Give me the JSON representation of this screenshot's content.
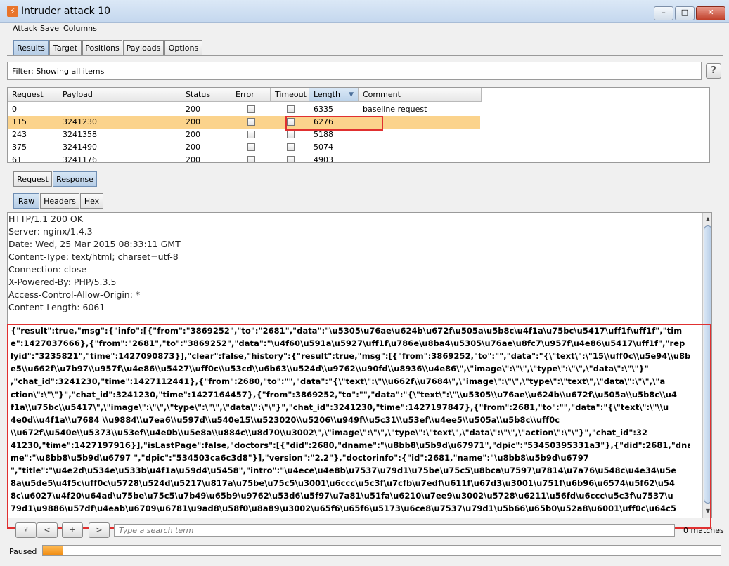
{
  "window": {
    "title": "Intruder attack 10",
    "icon": "burp-logo-icon"
  },
  "menu": [
    "Attack",
    "Save",
    "Columns"
  ],
  "main_tabs": [
    {
      "label": "Results",
      "active": true
    },
    {
      "label": "Target",
      "active": false
    },
    {
      "label": "Positions",
      "active": false
    },
    {
      "label": "Payloads",
      "active": false
    },
    {
      "label": "Options",
      "active": false
    }
  ],
  "filter": {
    "text": "Filter:  Showing all items",
    "help": "?"
  },
  "table": {
    "columns": [
      "Request",
      "Payload",
      "Status",
      "Error",
      "Timeout",
      "Length",
      "Comment"
    ],
    "sorted_column": "Length",
    "rows": [
      {
        "request": "0",
        "payload": "",
        "status": "200",
        "error": false,
        "timeout": false,
        "length": "6335",
        "comment": "baseline request",
        "selected": false
      },
      {
        "request": "115",
        "payload": "3241230",
        "status": "200",
        "error": false,
        "timeout": false,
        "length": "6276",
        "comment": "",
        "selected": true
      },
      {
        "request": "243",
        "payload": "3241358",
        "status": "200",
        "error": false,
        "timeout": false,
        "length": "5188",
        "comment": "",
        "selected": false
      },
      {
        "request": "375",
        "payload": "3241490",
        "status": "200",
        "error": false,
        "timeout": false,
        "length": "5074",
        "comment": "",
        "selected": false
      },
      {
        "request": "61",
        "payload": "3241176",
        "status": "200",
        "error": false,
        "timeout": false,
        "length": "4903",
        "comment": "",
        "selected": false
      }
    ]
  },
  "detail_tabs": [
    {
      "label": "Request",
      "active": false
    },
    {
      "label": "Response",
      "active": true
    }
  ],
  "view_tabs": [
    {
      "label": "Raw",
      "active": true
    },
    {
      "label": "Headers",
      "active": false
    },
    {
      "label": "Hex",
      "active": false
    }
  ],
  "response": {
    "headers": [
      "HTTP/1.1 200 OK",
      "Server: nginx/1.4.3",
      "Date: Wed, 25 Mar 2015 08:33:11 GMT",
      "Content-Type: text/html; charset=utf-8",
      "Connection: close",
      "X-Powered-By: PHP/5.3.5",
      "Access-Control-Allow-Origin: *",
      "Content-Length: 6061"
    ],
    "body_lines": [
      "{\"result\":true,\"msg\":{\"info\":[{\"from\":\"3869252\",\"to\":\"2681\",\"data\":\"\\u5305\\u76ae\\u624b\\u672f\\u505a\\u5b8c\\u4f1a\\u75bc\\u5417\\uff1f\\uff1f\",\"tim",
      "e\":1427037666},{\"from\":\"2681\",\"to\":\"3869252\",\"data\":\"\\u4f60\\u591a\\u5927\\uff1f\\u786e\\u8ba4\\u5305\\u76ae\\u8fc7\\u957f\\u4e86\\u5417\\uff1f\",\"rep",
      "lyid\":\"3235821\",\"time\":1427090873}],\"clear\":false,\"history\":{\"result\":true,\"msg\":[{\"from\":3869252,\"to\":\"\",\"data\":\"{\\\"text\\\":\\\"15\\\\uff0c\\\\u5e94\\\\u8b",
      "e5\\\\u662f\\\\u7b97\\\\u957f\\\\u4e86\\\\u5427\\\\uff0c\\\\u53cd\\\\u6b63\\\\u524d\\\\u9762\\\\u90fd\\\\u8936\\\\u4e86\\\",\\\"image\\\":\\\"\\\",\\\"type\\\":\\\"\\\",\\\"data\\\":\\\"\\\"}\"",
      ",\"chat_id\":3241230,\"time\":1427112441},{\"from\":2680,\"to\":\"\",\"data\":\"{\\\"text\\\":\\\"\\\\u662f\\\\u7684\\\",\\\"image\\\":\\\"\\\",\\\"type\\\":\\\"text\\\",\\\"data\\\":\\\"\\\",\\\"a",
      "ction\\\":\\\"\\\"}\",\"chat_id\":3241230,\"time\":1427164457},{\"from\":3869252,\"to\":\"\",\"data\":\"{\\\"text\\\":\\\"\\\\u5305\\\\u76ae\\\\u624b\\\\u672f\\\\u505a\\\\u5b8c\\\\u4",
      "f1a\\\\u75bc\\\\u5417\\\",\\\"image\\\":\\\"\\\",\\\"type\\\":\\\"\\\",\\\"data\\\":\\\"\\\"}\",\"chat_id\":3241230,\"time\":1427197847},{\"from\":2681,\"to\":\"\",\"data\":\"{\\\"text\\\":\\\"\\\\u",
      "4e0d\\\\u4f1a\\\\u7684  \\\\u9884\\\\u7ea6\\\\u597d\\\\u540e15\\\\u523020\\\\u5206\\\\u949f\\\\u5c31\\\\u53ef\\\\u4ee5\\\\u505a\\\\u5b8c\\\\uff0c",
      "\\\\u672f\\\\u540e\\\\u5373\\\\u53ef\\\\u4e0b\\\\u5e8a\\\\u884c\\\\u8d70\\\\u3002\\\",\\\"image\\\":\\\"\\\",\\\"type\\\":\\\"text\\\",\\\"data\\\":\\\"\\\",\\\"action\\\":\\\"\\\"}\",\"chat_id\":32",
      "41230,\"time\":1427197916}],\"isLastPage\":false,\"doctors\":[{\"did\":2680,\"dname\":\"\\u8bb8\\u5b9d\\u67971\",\"dpic\":\"53450395331a3\"},{\"did\":2681,\"dna",
      "me\":\"\\u8bb8\\u5b9d\\u6797 \",\"dpic\":\"534503ca6c3d8\"}],\"version\":\"2.2\"},\"doctorinfo\":{\"id\":2681,\"name\":\"\\u8bb8\\u5b9d\\u6797",
      "\",\"title\":\"\\u4e2d\\u534e\\u533b\\u4f1a\\u59d4\\u5458\",\"intro\":\"\\u4ece\\u4e8b\\u7537\\u79d1\\u75be\\u75c5\\u8bca\\u7597\\u7814\\u7a76\\u548c\\u4e34\\u5e",
      "8a\\u5de5\\u4f5c\\uff0c\\u5728\\u524d\\u5217\\u817a\\u75be\\u75c5\\u3001\\u6ccc\\u5c3f\\u7cfb\\u7edf\\u611f\\u67d3\\u3001\\u751f\\u6b96\\u6574\\u5f62\\u54",
      "8c\\u6027\\u4f20\\u64ad\\u75be\\u75c5\\u7b49\\u65b9\\u9762\\u53d6\\u5f97\\u7a81\\u51fa\\u6210\\u7ee9\\u3002\\u5728\\u6211\\u56fd\\u6ccc\\u5c3f\\u7537\\u",
      "79d1\\u9886\\u57df\\u4eab\\u6709\\u6781\\u9ad8\\u58f0\\u8a89\\u3002\\u65f6\\u65f6\\u5173\\u6ce8\\u7537\\u79d1\\u5b66\\u65b0\\u52a8\\u6001\\uff0c\\u64c5"
    ]
  },
  "search": {
    "buttons": [
      "?",
      "<",
      "+",
      ">"
    ],
    "placeholder": "Type a search term",
    "matches": "0 matches"
  },
  "status": {
    "label": "Paused",
    "progress_fraction": 0.03
  },
  "colors": {
    "selected_row": "#fbd38c",
    "highlight_box": "#e03030",
    "progress": "#f08a10"
  }
}
